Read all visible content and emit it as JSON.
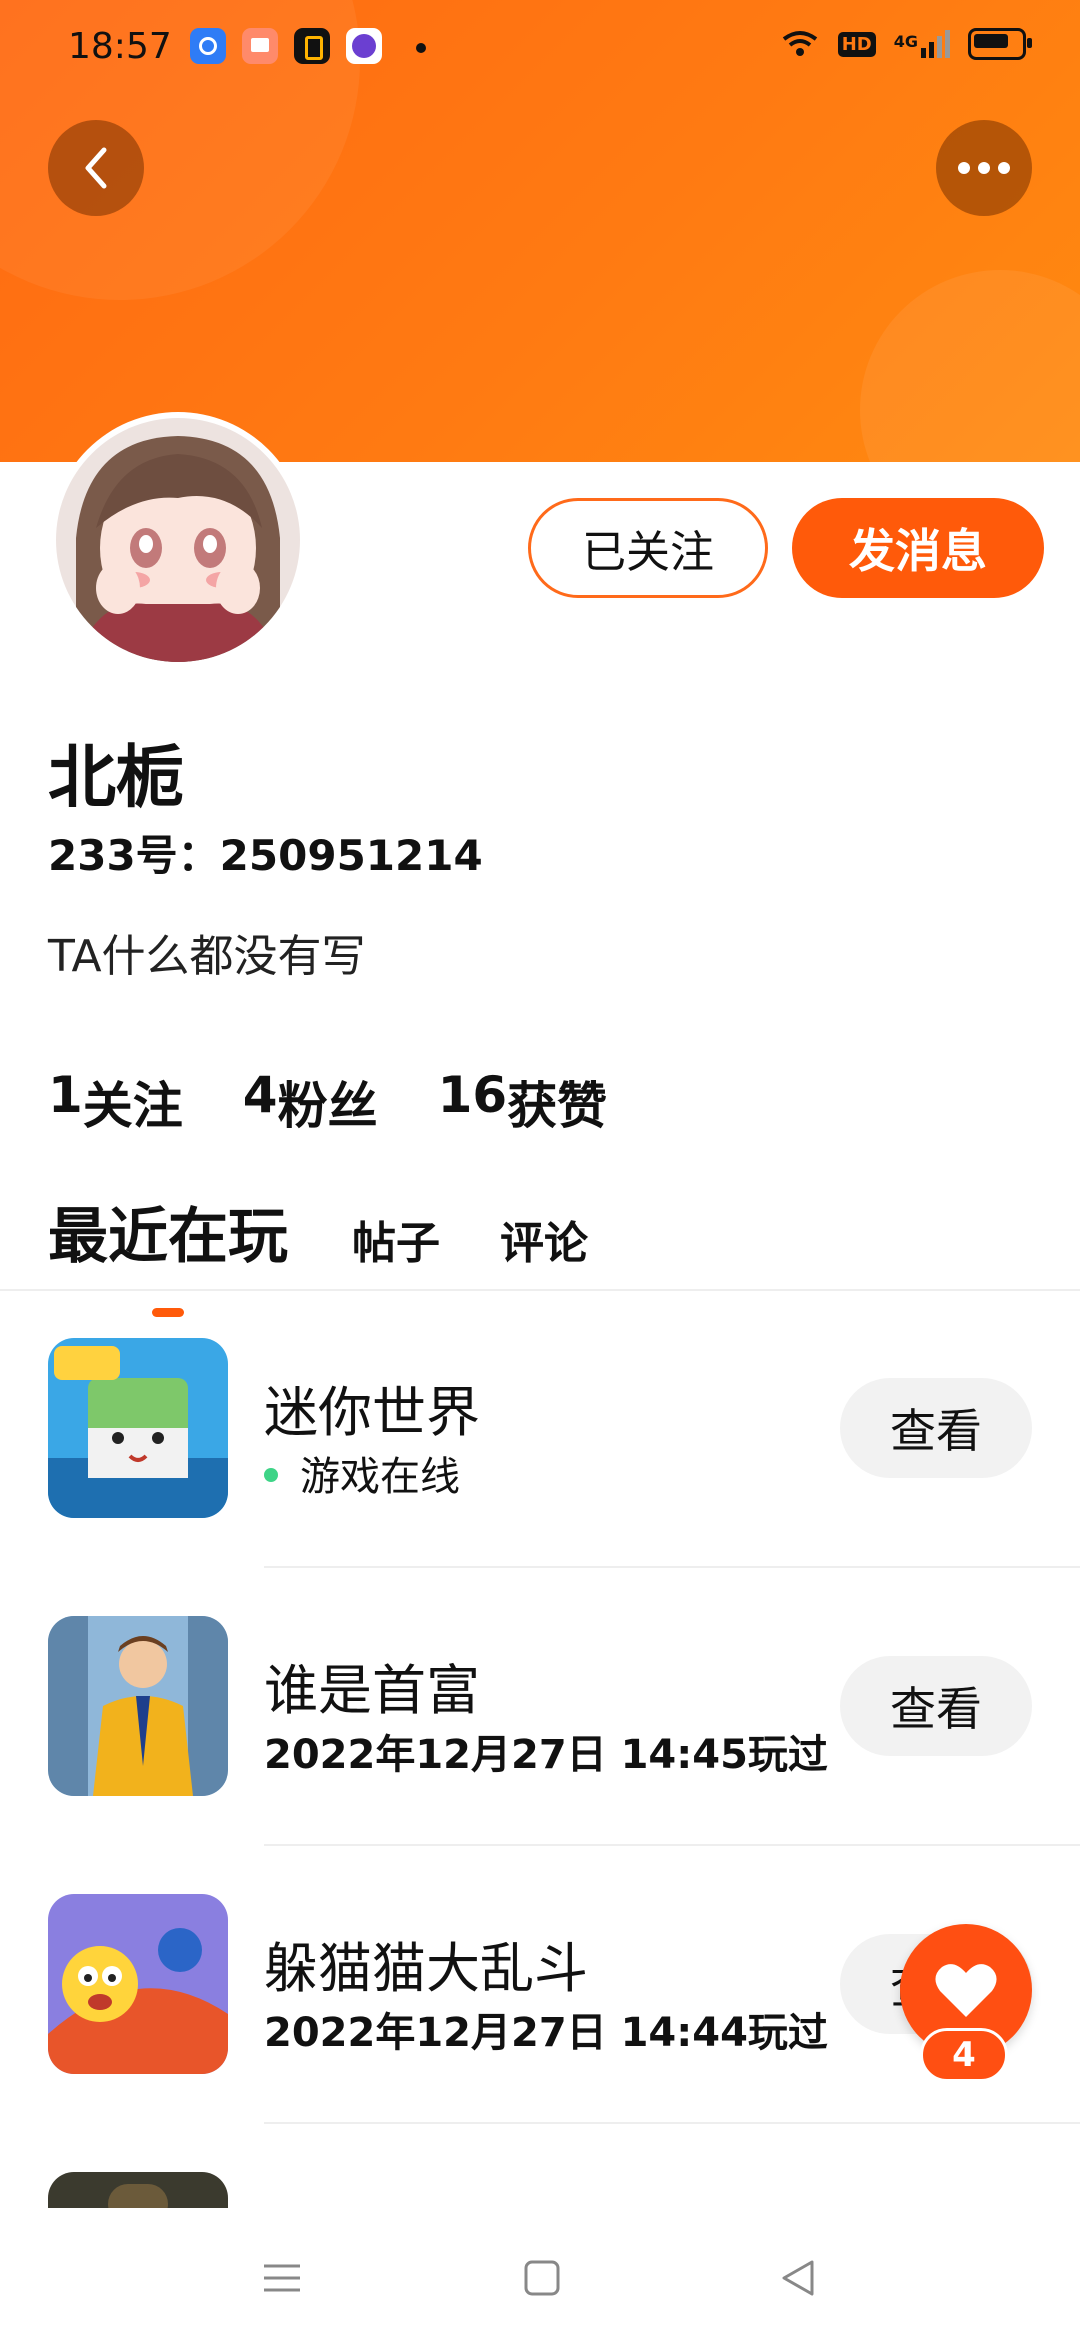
{
  "status_bar": {
    "time": "18:57",
    "hd_label": "HD",
    "network_label": "4G"
  },
  "profile": {
    "name": "北栀",
    "uid": "233号：250951214",
    "bio": "TA什么都没有写",
    "follow_button": "已关注",
    "message_button": "发消息"
  },
  "stats": [
    {
      "value": "1",
      "label": "关注"
    },
    {
      "value": "4",
      "label": "粉丝"
    },
    {
      "value": "16",
      "label": "获赞"
    }
  ],
  "tabs": [
    {
      "label": "最近在玩",
      "active": true
    },
    {
      "label": "帖子",
      "active": false
    },
    {
      "label": "评论",
      "active": false
    }
  ],
  "games": [
    {
      "title": "迷你世界",
      "subtitle": "游戏在线",
      "online": true,
      "button": "查看"
    },
    {
      "title": "谁是首富",
      "subtitle": "2022年12月27日 14:45玩过",
      "online": false,
      "button": "查看"
    },
    {
      "title": "躲猫猫大乱斗",
      "subtitle": "2022年12月27日 14:44玩过",
      "online": false,
      "button": "查看"
    }
  ],
  "like_fab": {
    "count": "4"
  },
  "colors": {
    "accent": "#ff5a0a",
    "banner": "#ff7a12",
    "online": "#3ed487"
  }
}
